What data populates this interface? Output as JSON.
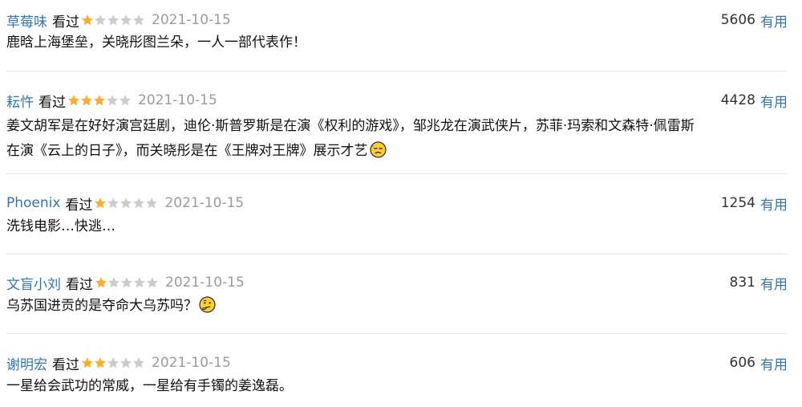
{
  "colors": {
    "link": "#3377aa",
    "star_filled": "#ffac2d",
    "star_empty": "#cccccc",
    "date": "#9b9b9b",
    "divider": "#e8e8e8"
  },
  "comments": [
    {
      "user": "草莓味",
      "status": "看过",
      "rating": 1,
      "max_rating": 5,
      "date": "2021-10-15",
      "votes": "5606",
      "useful_label": "有用",
      "lines": [
        "鹿晗上海堡垒，关晓彤图兰朵，一人一部代表作！"
      ],
      "emoji": ""
    },
    {
      "user": "耘忤",
      "status": "看过",
      "rating": 3,
      "max_rating": 5,
      "date": "2021-10-15",
      "votes": "4428",
      "useful_label": "有用",
      "lines": [
        "姜文胡军是在好好演宫廷剧，迪伦·斯普罗斯是在演《权利的游戏》，邹兆龙在演武侠片，苏菲·玛索和文森特·佩雷斯",
        "在演《云上的日子》，而关晓彤是在《王牌对王牌》展示才艺"
      ],
      "emoji": "sweat-face-icon"
    },
    {
      "user": "Phoenix",
      "status": "看过",
      "rating": 1,
      "max_rating": 5,
      "date": "2021-10-15",
      "votes": "1254",
      "useful_label": "有用",
      "lines": [
        "洗钱电影…快逃…"
      ],
      "emoji": ""
    },
    {
      "user": "文盲小刘",
      "status": "看过",
      "rating": 1,
      "max_rating": 5,
      "date": "2021-10-15",
      "votes": "831",
      "useful_label": "有用",
      "lines": [
        "乌苏国进贡的是夺命大乌苏吗？"
      ],
      "emoji": "thinking-face-icon"
    },
    {
      "user": "谢明宏",
      "status": "看过",
      "rating": 2,
      "max_rating": 5,
      "date": "2021-10-15",
      "votes": "606",
      "useful_label": "有用",
      "lines": [
        "一星给会武功的常威，一星给有手镯的姜逸磊。"
      ],
      "emoji": ""
    }
  ]
}
